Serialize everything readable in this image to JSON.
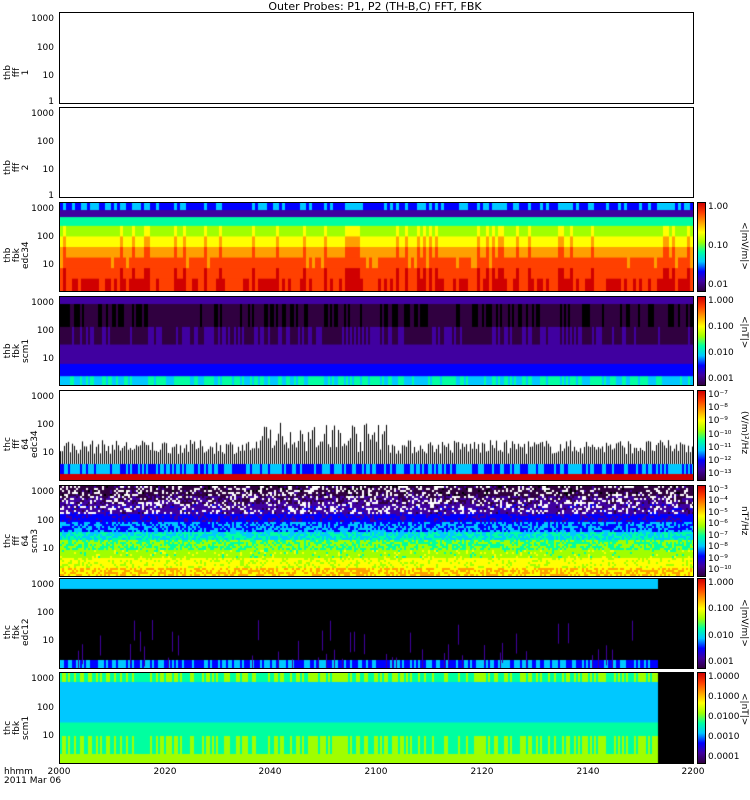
{
  "title": "Outer Probes: P1, P2 (TH-B,C) FFT, FBK",
  "panels": [
    {
      "ylabel": "thb\nfff\n1",
      "yticks": [
        "1000",
        "100",
        "10",
        "1"
      ],
      "cbar": null
    },
    {
      "ylabel": "thb\nfff\n2",
      "yticks": [
        "1000",
        "100",
        "10",
        "1"
      ],
      "cbar": null
    },
    {
      "ylabel": "thb\nfbk\nedc34",
      "yticks": [
        "1000",
        "100",
        "10"
      ],
      "cbar": {
        "title": "<|mV/m|>",
        "ticks": [
          "1.00",
          "0.10",
          "0.01"
        ]
      }
    },
    {
      "ylabel": "thb\nfbk\nscm1",
      "yticks": [
        "1000",
        "100",
        "10"
      ],
      "cbar": {
        "title": "<|nT|>",
        "ticks": [
          "1.000",
          "0.100",
          "0.010",
          "0.001"
        ]
      }
    },
    {
      "ylabel": "thc\nfff\n64\nedc34",
      "yticks": [
        "1000",
        "100",
        "10"
      ],
      "cbar": {
        "title": "(V/m)²/Hz",
        "ticks": [
          "10⁻⁷",
          "10⁻⁸",
          "10⁻⁹",
          "10⁻¹⁰",
          "10⁻¹¹",
          "10⁻¹²",
          "10⁻¹³"
        ]
      }
    },
    {
      "ylabel": "thc\nfff\n64\nscm3",
      "yticks": [
        "1000",
        "100",
        "10"
      ],
      "cbar": {
        "title": "nT²/Hz",
        "ticks": [
          "10⁻³",
          "10⁻⁴",
          "10⁻⁵",
          "10⁻⁶",
          "10⁻⁷",
          "10⁻⁸",
          "10⁻⁹",
          "10⁻¹⁰"
        ]
      }
    },
    {
      "ylabel": "thc\nfbk\nedc12",
      "yticks": [
        "1000",
        "100",
        "10"
      ],
      "cbar": {
        "title": "<|mV/m|>",
        "ticks": [
          "1.000",
          "0.100",
          "0.010",
          "0.001"
        ]
      }
    },
    {
      "ylabel": "thc\nfbk\nscm1",
      "yticks": [
        "1000",
        "100",
        "10"
      ],
      "cbar": {
        "title": "<|nT|>",
        "ticks": [
          "1.0000",
          "0.1000",
          "0.0100",
          "0.0010",
          "0.0001"
        ]
      }
    }
  ],
  "xaxis": {
    "ticks": [
      "2000",
      "2020",
      "2040",
      "2100",
      "2120",
      "2140",
      "2200"
    ]
  },
  "footer": {
    "line1": "hhmm",
    "line2": "2011 Mar 06"
  },
  "chart_data": {
    "type": "heatmap",
    "title": "Outer Probes: P1, P2 (TH-B,C) FFT, FBK",
    "x_range": [
      "20:00",
      "22:00"
    ],
    "y_scale": "log",
    "y_range": [
      1,
      2000
    ],
    "series": [
      {
        "name": "thb fff 1",
        "note": "empty"
      },
      {
        "name": "thb fff 2",
        "note": "empty"
      },
      {
        "name": "thb fbk edc34",
        "units": "<|mV/m|>",
        "colorbar_range": [
          0.01,
          1.0
        ],
        "scale": "log"
      },
      {
        "name": "thb fbk scm1",
        "units": "<|nT|>",
        "colorbar_range": [
          0.001,
          1.0
        ],
        "scale": "log"
      },
      {
        "name": "thc fff 64 edc34",
        "units": "(V/m)^2/Hz",
        "colorbar_range": [
          1e-13,
          1e-07
        ],
        "scale": "log"
      },
      {
        "name": "thc fff 64 scm3",
        "units": "nT^2/Hz",
        "colorbar_range": [
          1e-10,
          0.001
        ],
        "scale": "log"
      },
      {
        "name": "thc fbk edc12",
        "units": "<|mV/m|>",
        "colorbar_range": [
          0.001,
          1.0
        ],
        "scale": "log"
      },
      {
        "name": "thc fbk scm1",
        "units": "<|nT|>",
        "colorbar_range": [
          0.0001,
          1.0
        ],
        "scale": "log"
      }
    ],
    "colors": {
      "low": "#ffffff",
      "scale": [
        "#000000",
        "#300040",
        "#4000a0",
        "#0000ff",
        "#00c8ff",
        "#00ffa0",
        "#a0ff00",
        "#ffff00",
        "#ffa000",
        "#ff4000",
        "#d00000"
      ]
    }
  }
}
